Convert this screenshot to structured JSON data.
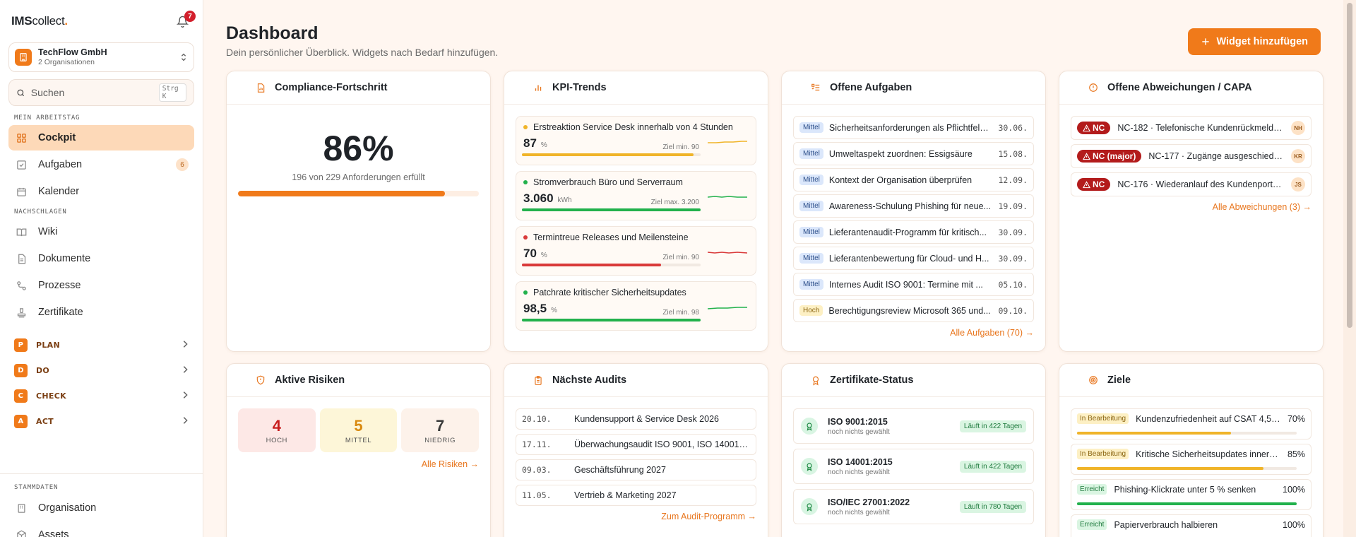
{
  "app": {
    "logo_bold": "IMS",
    "logo_rest": "collect",
    "logo_dot": ".",
    "notifications": "7"
  },
  "org": {
    "name": "TechFlow GmbH",
    "sub": "2 Organisationen"
  },
  "search": {
    "placeholder": "Suchen",
    "shortcut": "Strg K"
  },
  "sections": {
    "work": "MEIN ARBEITSTAG",
    "lookup": "NACHSCHLAGEN",
    "master": "STAMMDATEN"
  },
  "nav": {
    "cockpit": "Cockpit",
    "tasks": "Aufgaben",
    "tasks_count": "6",
    "calendar": "Kalender",
    "wiki": "Wiki",
    "documents": "Dokumente",
    "processes": "Prozesse",
    "certificates": "Zertifikate",
    "organisation": "Organisation",
    "assets": "Assets"
  },
  "pdca": [
    {
      "letter": "P",
      "label": "PLAN"
    },
    {
      "letter": "D",
      "label": "DO"
    },
    {
      "letter": "C",
      "label": "CHECK"
    },
    {
      "letter": "A",
      "label": "ACT"
    }
  ],
  "header": {
    "title": "Dashboard",
    "subtitle": "Dein persönlicher Überblick. Widgets nach Bedarf hinzufügen.",
    "add_button": "Widget hinzufügen"
  },
  "compliance": {
    "title": "Compliance-Fortschritt",
    "percent_label": "86%",
    "percent": 86,
    "sub": "196 von 229 Anforderungen erfüllt"
  },
  "kpi": {
    "title": "KPI-Trends",
    "items": [
      {
        "name": "Erstreaktion Service Desk innerhalb von 4 Stunden",
        "value": "87",
        "unit": "%",
        "target": "Ziel min. 90",
        "fill": 0.96,
        "color": "#f0b429"
      },
      {
        "name": "Stromverbrauch Büro und Serverraum",
        "value": "3.060",
        "unit": "kWh",
        "target": "Ziel max. 3.200",
        "fill": 1.0,
        "color": "#22b14c"
      },
      {
        "name": "Termintreue Releases und Meilensteine",
        "value": "70",
        "unit": "%",
        "target": "Ziel min. 90",
        "fill": 0.78,
        "color": "#d93a3a"
      },
      {
        "name": "Patchrate kritischer Sicherheitsupdates",
        "value": "98,5",
        "unit": "%",
        "target": "Ziel min. 98",
        "fill": 1.0,
        "color": "#22b14c"
      }
    ]
  },
  "tasks": {
    "title": "Offene Aufgaben",
    "link": "Alle Aufgaben (70) →",
    "items": [
      {
        "priority": "Mittel",
        "text": "Sicherheitsanforderungen als Pflichtfeld...",
        "date": "30.06."
      },
      {
        "priority": "Mittel",
        "text": "Umweltaspekt zuordnen: Essigsäure",
        "date": "15.08."
      },
      {
        "priority": "Mittel",
        "text": "Kontext der Organisation überprüfen",
        "date": "12.09."
      },
      {
        "priority": "Mittel",
        "text": "Awareness-Schulung Phishing für neue...",
        "date": "19.09."
      },
      {
        "priority": "Mittel",
        "text": "Lieferantenaudit-Programm für kritisch...",
        "date": "30.09."
      },
      {
        "priority": "Mittel",
        "text": "Lieferantenbewertung für Cloud- und H...",
        "date": "30.09."
      },
      {
        "priority": "Mittel",
        "text": "Internes Audit ISO 9001: Termine mit ...",
        "date": "05.10."
      },
      {
        "priority": "Hoch",
        "text": "Berechtigungsreview Microsoft 365 und...",
        "date": "09.10."
      }
    ]
  },
  "capa": {
    "title": "Offene Abweichungen / CAPA",
    "link": "Alle Abweichungen (3) →",
    "items": [
      {
        "badge": "NC",
        "text": "NC-182 · Telefonische Kundenrückmeldun...",
        "avatar": "NH"
      },
      {
        "badge": "NC (major)",
        "text": "NC-177 · Zugänge ausgeschieden...",
        "avatar": "KR"
      },
      {
        "badge": "NC",
        "text": "NC-176 · Wiederanlauf des Kundenportals...",
        "avatar": "JS"
      }
    ]
  },
  "risks": {
    "title": "Aktive Risiken",
    "link": "Alle Risiken →",
    "items": [
      {
        "value": "4",
        "label": "HOCH",
        "color": "#c81e1e",
        "bg": "#fde8e6"
      },
      {
        "value": "5",
        "label": "MITTEL",
        "color": "#d98a10",
        "bg": "#fdf6d8"
      },
      {
        "value": "7",
        "label": "NIEDRIG",
        "color": "#3a3a3a",
        "bg": "#fdf2ea"
      }
    ]
  },
  "audits": {
    "title": "Nächste Audits",
    "link": "Zum Audit-Programm →",
    "items": [
      {
        "date": "20.10.",
        "text": "Kundensupport & Service Desk 2026"
      },
      {
        "date": "17.11.",
        "text": "Überwachungsaudit ISO 9001, ISO 14001 u..."
      },
      {
        "date": "09.03.",
        "text": "Geschäftsführung 2027"
      },
      {
        "date": "11.05.",
        "text": "Vertrieb & Marketing 2027"
      }
    ]
  },
  "certs": {
    "title": "Zertifikate-Status",
    "items": [
      {
        "name": "ISO 9001:2015",
        "sub": "noch nichts gewählt",
        "badge": "Läuft in 422 Tagen"
      },
      {
        "name": "ISO 14001:2015",
        "sub": "noch nichts gewählt",
        "badge": "Läuft in 422 Tagen"
      },
      {
        "name": "ISO/IEC 27001:2022",
        "sub": "noch nichts gewählt",
        "badge": "Läuft in 780 Tagen"
      }
    ]
  },
  "goals": {
    "title": "Ziele",
    "items": [
      {
        "status": "In Bearbeitung",
        "text": "Kundenzufriedenheit auf CSAT 4,5 ...",
        "pct": "70%",
        "fill": 0.7,
        "color": "#f0b429"
      },
      {
        "status": "In Bearbeitung",
        "text": "Kritische Sicherheitsupdates innerh...",
        "pct": "85%",
        "fill": 0.85,
        "color": "#f0b429"
      },
      {
        "status": "Erreicht",
        "text": "Phishing-Klickrate unter 5 % senken",
        "pct": "100%",
        "fill": 1.0,
        "color": "#22b14c"
      },
      {
        "status": "Erreicht",
        "text": "Papierverbrauch halbieren",
        "pct": "100%",
        "fill": 1.0,
        "color": "#22b14c"
      }
    ]
  },
  "colors": {
    "accent": "#f07a1a",
    "active_bg": "#fdd9b8"
  }
}
